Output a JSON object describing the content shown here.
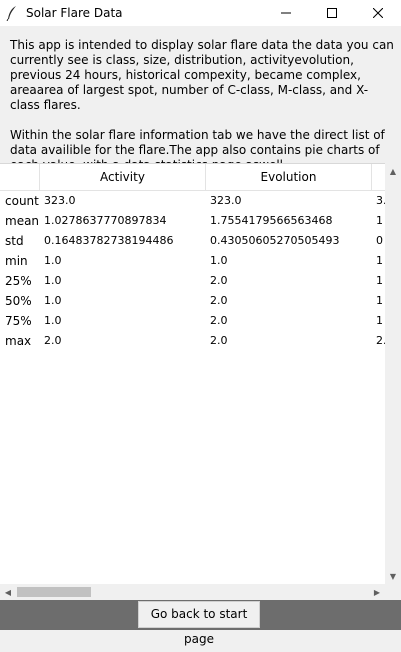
{
  "window": {
    "title": "Solar Flare Data",
    "icon": "feather-icon"
  },
  "intro": {
    "paragraph1": "This app is intended to display solar flare data the data you can currently see is class, size, distribution, activityevolution, previous 24 hours, historical compexity, became complex, areaarea of largest spot, number of C-class, M-class, and X-class flares.",
    "paragraph2": "Within the solar flare information tab we have the direct list of data availible for the flare.The app also contains pie charts of each value, with a data statistics page aswell."
  },
  "table": {
    "columns": [
      "",
      "Activity",
      "Evolution",
      ""
    ],
    "rows": [
      {
        "label": "count",
        "activity": "323.0",
        "evolution": "323.0",
        "next": "3."
      },
      {
        "label": "mean",
        "activity": "1.0278637770897834",
        "evolution": "1.7554179566563468",
        "next": "1"
      },
      {
        "label": "std",
        "activity": "0.16483782738194486",
        "evolution": "0.430506052705054​93",
        "next": "0"
      },
      {
        "label": "min",
        "activity": "1.0",
        "evolution": "1.0",
        "next": "1"
      },
      {
        "label": "25%",
        "activity": "1.0",
        "evolution": "2.0",
        "next": "1"
      },
      {
        "label": "50%",
        "activity": "1.0",
        "evolution": "2.0",
        "next": "1"
      },
      {
        "label": "75%",
        "activity": "1.0",
        "evolution": "2.0",
        "next": "1"
      },
      {
        "label": "max",
        "activity": "2.0",
        "evolution": "2.0",
        "next": "2."
      }
    ]
  },
  "footer": {
    "back_button": "Go back to start page"
  }
}
